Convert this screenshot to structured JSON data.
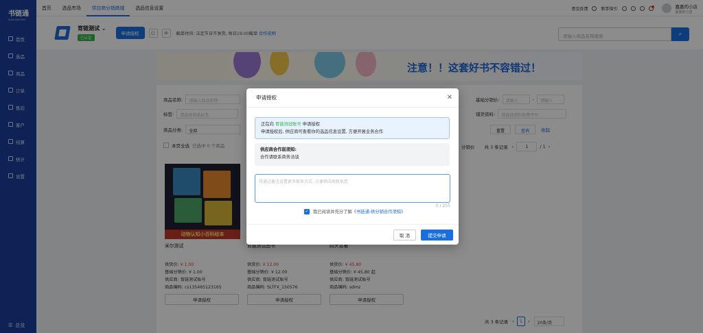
{
  "brand": {
    "name": "书链通",
    "sub": "SHULIANTONG"
  },
  "sidebar": {
    "items": [
      {
        "label": "首页"
      },
      {
        "label": "选品"
      },
      {
        "label": "商品"
      },
      {
        "label": "订单"
      },
      {
        "label": "售后"
      },
      {
        "label": "客户"
      },
      {
        "label": "结算"
      },
      {
        "label": "统计"
      },
      {
        "label": "设置"
      }
    ],
    "footer": "总览"
  },
  "topnav": {
    "items": [
      "首页",
      "选品市场",
      "供应商分销商城",
      "选品信息设置"
    ],
    "active": 2
  },
  "topright": {
    "feedback": "意见反馈",
    "guide": "新手指引",
    "user_name": "嘉嘉的小店",
    "user_sub": "嘉嘉的小店"
  },
  "header": {
    "shop_name": "育链测试",
    "certified": "已认证",
    "apply_btn": "申请授权",
    "notice": "截单时间: 法定节日不发货, 每日19:00截单",
    "notice_link": "合作说明",
    "search_placeholder": "请输入商品名称搜索"
  },
  "banner": {
    "text": "注意！！这套好书不容错过！"
  },
  "filters": {
    "name_label": "商品名称:",
    "name_ph": "请输入商品名称",
    "tag_label": "标签:",
    "tag_ph": "请选择商品标签",
    "cat_label": "商品分类:",
    "cat_val": "全部",
    "base_price_label": "基础分销价:",
    "base_ph": "请输入",
    "stock_label": "铺货资料:",
    "stock_ph": "请选择资料免费平台",
    "reset": "重置",
    "query": "查询",
    "collapse": "收起",
    "select_all": "本页全选",
    "selected": "已选中 0 个商品",
    "sort": "分销价",
    "total": "共 3 条记录",
    "page": "1",
    "pages": "/ 1"
  },
  "products": [
    {
      "title": "米尔测试",
      "supply_label": "供货价:",
      "supply": "¥ 1.00",
      "base_label": "基础分销价:",
      "base": "¥ 1.00",
      "vendor_label": "供应商:",
      "vendor": "育链测试账号",
      "code_label": "商品编码:",
      "code": "cs135465123165",
      "apply": "申请授权"
    },
    {
      "title": "育链测试图书",
      "supply_label": "供货价:",
      "supply": "¥ 12.00",
      "base_label": "基础分销价:",
      "base": "¥ 12.00",
      "vendor_label": "供应商:",
      "vendor": "育链测试账号",
      "code_label": "商品编码:",
      "code": "SLTFX_150576",
      "apply": "申请授权"
    },
    {
      "title": "四大名著",
      "supply_label": "供货价:",
      "supply": "¥ 45.80",
      "base_label": "基础分销价:",
      "base": "¥ 45.80 起",
      "vendor_label": "供应商:",
      "vendor": "育链测试账号",
      "code_label": "商品编码:",
      "code": "sdmz",
      "apply": "申请授权"
    }
  ],
  "product_img_text": "动物认知小百科绘本",
  "pagination": {
    "total": "共 3 条记录",
    "page": "1",
    "size": "20条/页"
  },
  "modal": {
    "title": "申请授权",
    "info_prefix": "正在向",
    "info_account": "育链测试账号",
    "info_suffix": "申请授权",
    "info_desc": "申请授权后, 供应商可查看你的选品信息设置, 方便开展业务合作",
    "know_title": "供应商合作前须知:",
    "know_body": "合作请联系商务洽谈",
    "textarea_ph": "可通过备注设置更多联系方式, 方便供应商联系您",
    "counter": "0 / 255",
    "agree_prefix": "我已阅读并充分了解",
    "agree_link": "《书链通-供分销合作须知》",
    "cancel": "取 消",
    "submit": "提交申请"
  }
}
